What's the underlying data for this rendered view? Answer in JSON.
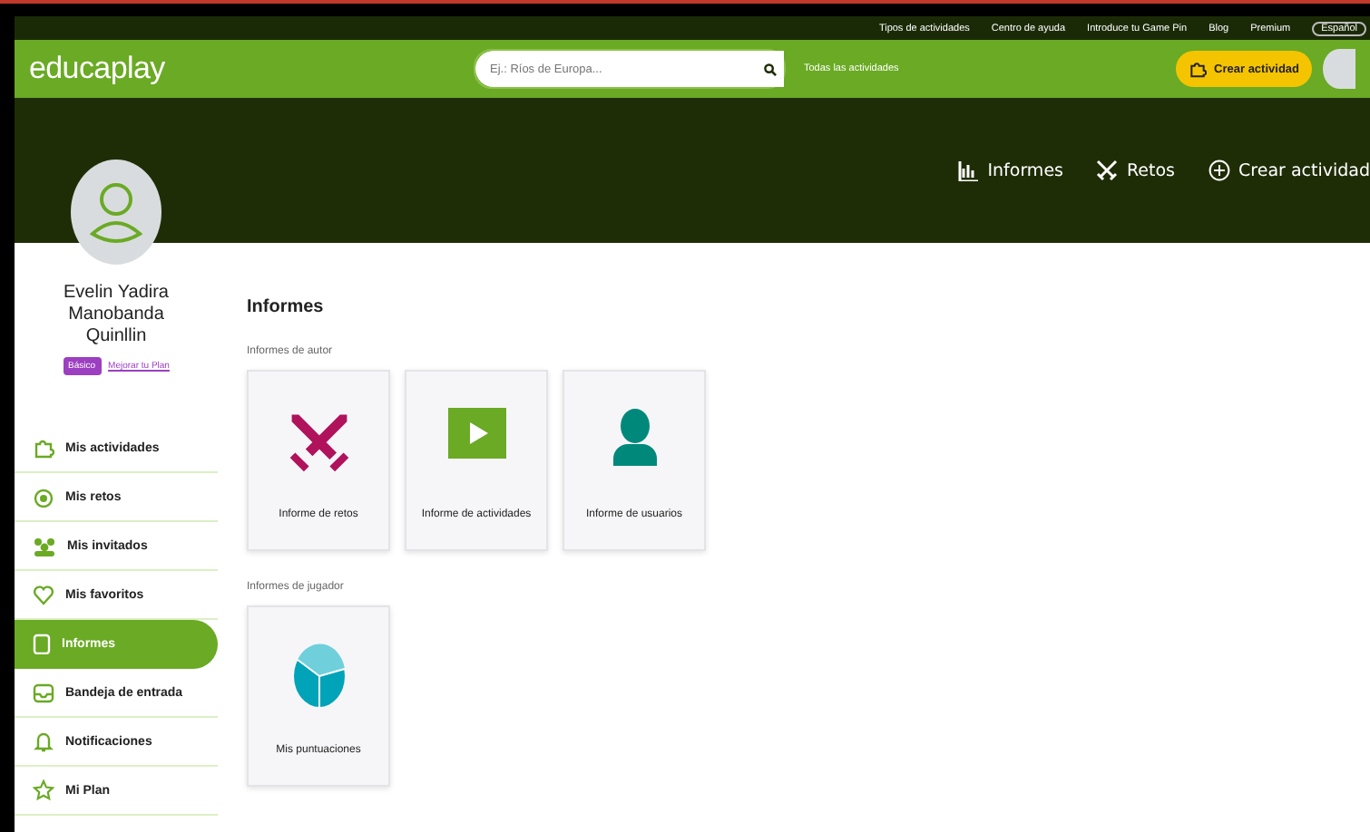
{
  "top_links": [
    "Tipos de actividades",
    "Centro de ayuda",
    "Introduce tu Game Pin",
    "Blog",
    "Premium"
  ],
  "language": "Español",
  "logo": "educaplay",
  "search": {
    "placeholder": "Ej.: Ríos de Europa...",
    "scope": "Todas las actividades"
  },
  "create_button": "Crear actividad",
  "banner_nav": [
    {
      "kind": "reports",
      "label": "Informes"
    },
    {
      "kind": "challenges",
      "label": "Retos"
    },
    {
      "kind": "create",
      "label": "Crear actividad"
    }
  ],
  "profile": {
    "name": "Evelin Yadira Manobanda Quinllin",
    "plan": "Básico",
    "upgrade_link": "Mejorar tu Plan"
  },
  "sidebar": {
    "items": [
      {
        "kind": "activities",
        "label": "Mis actividades",
        "selected": false
      },
      {
        "kind": "challenges",
        "label": "Mis retos",
        "selected": false
      },
      {
        "kind": "guests",
        "label": "Mis invitados",
        "selected": false
      },
      {
        "kind": "favorites",
        "label": "Mis favoritos",
        "selected": false
      },
      {
        "kind": "reports",
        "label": "Informes",
        "selected": true
      },
      {
        "kind": "inbox",
        "label": "Bandeja de entrada",
        "selected": false
      },
      {
        "kind": "notifications",
        "label": "Notificaciones",
        "selected": false
      },
      {
        "kind": "plan",
        "label": "Mi Plan",
        "selected": false
      }
    ]
  },
  "main": {
    "title": "Informes",
    "sections": [
      {
        "heading": "Informes de autor",
        "cards": [
          {
            "kind": "swords",
            "label": "Informe de retos"
          },
          {
            "kind": "play",
            "label": "Informe de actividades"
          },
          {
            "kind": "user",
            "label": "Informe de usuarios"
          }
        ]
      },
      {
        "heading": "Informes de jugador",
        "cards": [
          {
            "kind": "pie",
            "label": "Mis puntuaciones"
          }
        ]
      }
    ]
  }
}
